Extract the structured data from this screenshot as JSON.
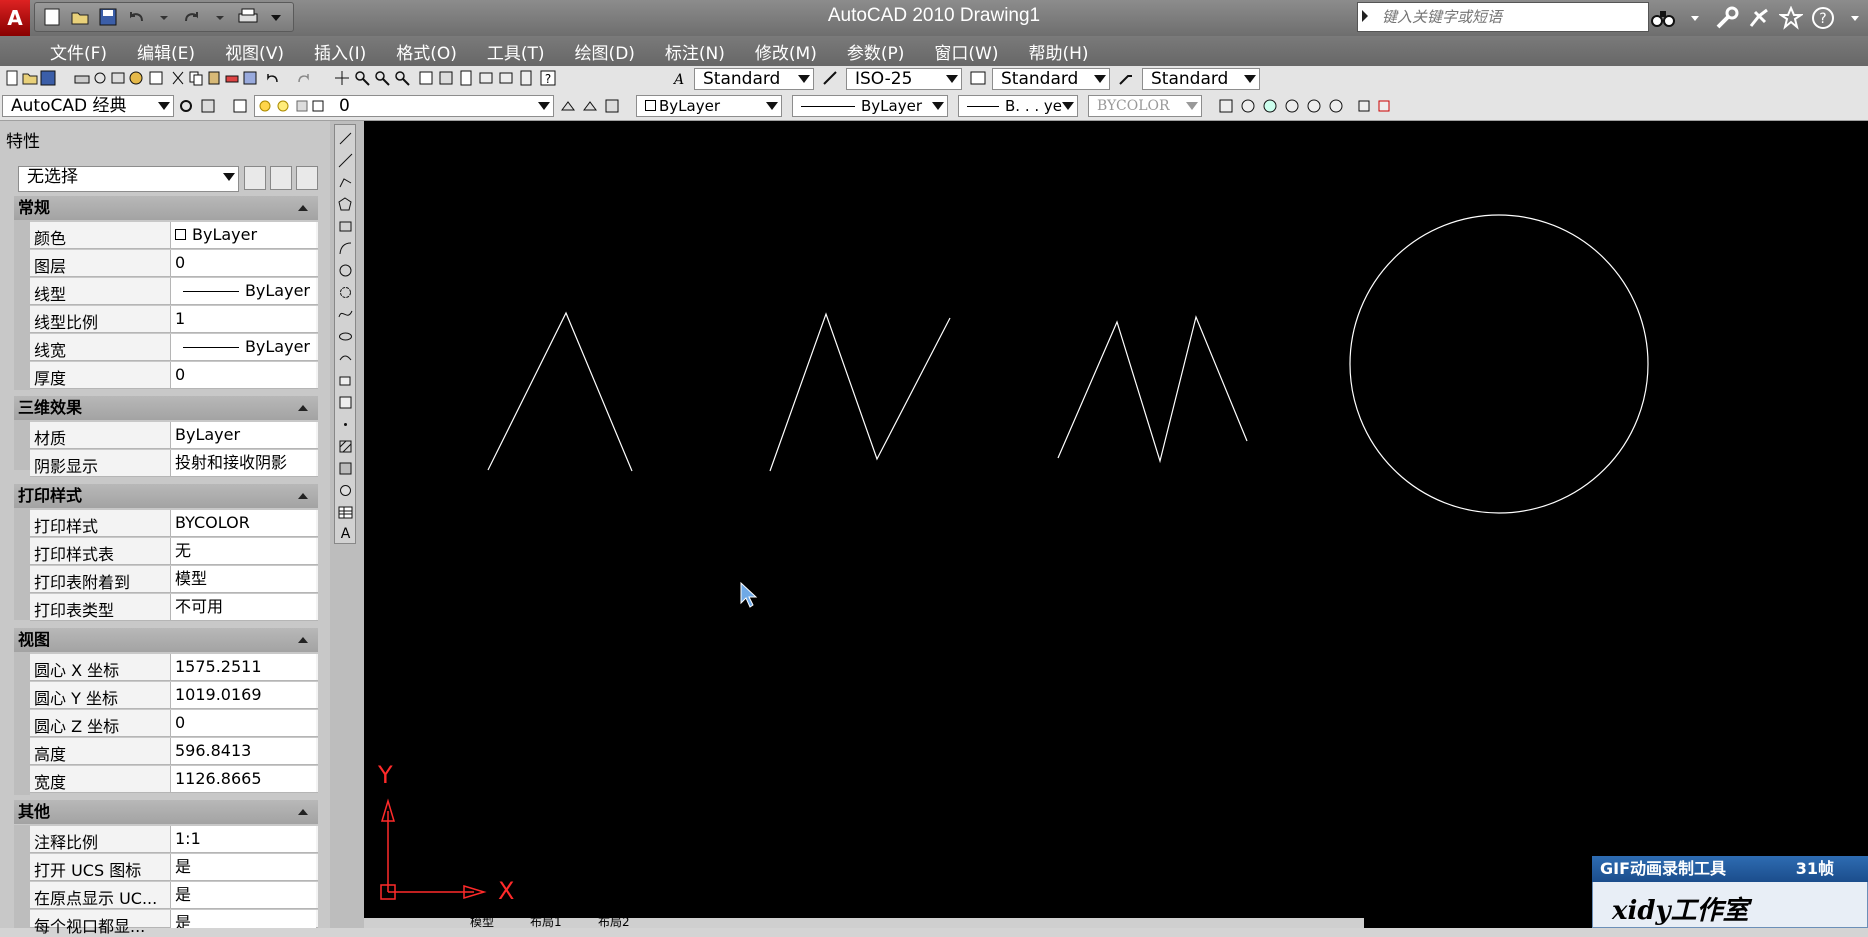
{
  "window": {
    "title": "AutoCAD 2010     Drawing1",
    "app_logo": "A"
  },
  "search": {
    "placeholder": "键入关键字或短语"
  },
  "menu": [
    "文件(F)",
    "编辑(E)",
    "视图(V)",
    "插入(I)",
    "格式(O)",
    "工具(T)",
    "绘图(D)",
    "标注(N)",
    "修改(M)",
    "参数(P)",
    "窗口(W)",
    "帮助(H)"
  ],
  "toolbar": {
    "text_style": "Standard",
    "dim_style": "ISO-25",
    "table_style": "Standard",
    "mleader_style": "Standard",
    "workspace": "AutoCAD 经典",
    "layer": "0",
    "color": "ByLayer",
    "linetype": "ByLayer",
    "lineweight": "B. . . ye",
    "plotstyle": "BYCOLOR"
  },
  "properties": {
    "title": "特性",
    "selection": "无选择",
    "sections": {
      "general": "常规",
      "effects3d": "三维效果",
      "plot": "打印样式",
      "view": "视图",
      "misc": "其他"
    },
    "general": [
      {
        "name": "颜色",
        "value": "ByLayer"
      },
      {
        "name": "图层",
        "value": "0"
      },
      {
        "name": "线型",
        "value": "ByLayer"
      },
      {
        "name": "线型比例",
        "value": "1"
      },
      {
        "name": "线宽",
        "value": "ByLayer"
      },
      {
        "name": "厚度",
        "value": "0"
      }
    ],
    "effects3d": [
      {
        "name": "材质",
        "value": "ByLayer"
      },
      {
        "name": "阴影显示",
        "value": "投射和接收阴影"
      }
    ],
    "plot": [
      {
        "name": "打印样式",
        "value": "BYCOLOR"
      },
      {
        "name": "打印样式表",
        "value": "无"
      },
      {
        "name": "打印表附着到",
        "value": "模型"
      },
      {
        "name": "打印表类型",
        "value": "不可用"
      }
    ],
    "view": [
      {
        "name": "圆心 X 坐标",
        "value": "1575.2511"
      },
      {
        "name": "圆心 Y 坐标",
        "value": "1019.0169"
      },
      {
        "name": "圆心 Z 坐标",
        "value": "0"
      },
      {
        "name": "高度",
        "value": "596.8413"
      },
      {
        "name": "宽度",
        "value": "1126.8665"
      }
    ],
    "misc": [
      {
        "name": "注释比例",
        "value": "1:1"
      },
      {
        "name": "打开 UCS 图标",
        "value": "是"
      },
      {
        "name": "在原点显示 UC...",
        "value": "是"
      },
      {
        "name": "每个视口都显...",
        "value": "是"
      }
    ]
  },
  "canvas": {
    "ucs_x": "X",
    "ucs_y": "Y"
  },
  "tabs": [
    "模型",
    "布局1",
    "布局2"
  ],
  "gif_recorder": {
    "title": "GIF动画录制工具",
    "frames": "31帧",
    "brand": "xidy工作室"
  },
  "colors": {
    "canvas": "#000000",
    "ucs": "#ff2a2a",
    "geometry": "#ffffff"
  }
}
